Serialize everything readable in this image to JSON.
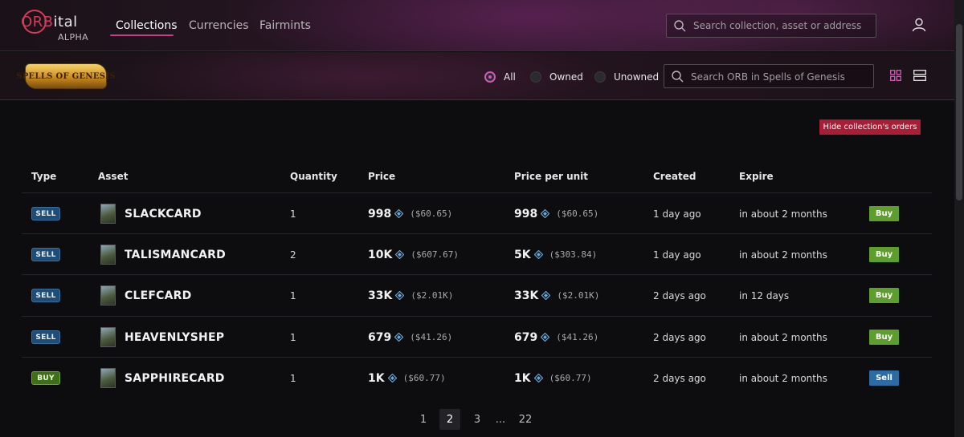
{
  "brand": {
    "logo_main": "ORBital",
    "logo_sub": "ALPHA"
  },
  "nav": {
    "collections": "Collections",
    "currencies": "Currencies",
    "fairmints": "Fairmints"
  },
  "top_search": {
    "placeholder": "Search collection, asset or address"
  },
  "collection": {
    "logo_text": "SPELLS OF GENESIS",
    "filters": {
      "all": "All",
      "owned": "Owned",
      "unowned": "Unowned",
      "selected": "All"
    },
    "search_placeholder": "Search ORB in Spells of Genesis"
  },
  "hide_orders_label": "Hide collection's orders",
  "table": {
    "headers": {
      "type": "Type",
      "asset": "Asset",
      "quantity": "Quantity",
      "price": "Price",
      "ppu": "Price per unit",
      "created": "Created",
      "expire": "Expire"
    },
    "rows": [
      {
        "type": "SELL",
        "asset": "SLACKCARD",
        "quantity": "1",
        "price": "998",
        "price_usd": "($60.65)",
        "ppu": "998",
        "ppu_usd": "($60.65)",
        "created": "1 day ago",
        "expire": "in about 2 months",
        "action": "Buy"
      },
      {
        "type": "SELL",
        "asset": "TALISMANCARD",
        "quantity": "2",
        "price": "10K",
        "price_usd": "($607.67)",
        "ppu": "5K",
        "ppu_usd": "($303.84)",
        "created": "1 day ago",
        "expire": "in about 2 months",
        "action": "Buy"
      },
      {
        "type": "SELL",
        "asset": "CLEFCARD",
        "quantity": "1",
        "price": "33K",
        "price_usd": "($2.01K)",
        "ppu": "33K",
        "ppu_usd": "($2.01K)",
        "created": "2 days ago",
        "expire": "in 12 days",
        "action": "Buy"
      },
      {
        "type": "SELL",
        "asset": "HEAVENLYSHEP",
        "quantity": "1",
        "price": "679",
        "price_usd": "($41.26)",
        "ppu": "679",
        "ppu_usd": "($41.26)",
        "created": "2 days ago",
        "expire": "in about 2 months",
        "action": "Buy"
      },
      {
        "type": "BUY",
        "asset": "SAPPHIRECARD",
        "quantity": "1",
        "price": "1K",
        "price_usd": "($60.77)",
        "ppu": "1K",
        "ppu_usd": "($60.77)",
        "created": "2 days ago",
        "expire": "in about 2 months",
        "action": "Sell"
      }
    ]
  },
  "pagination": {
    "p1": "1",
    "p2": "2",
    "p3": "3",
    "ellipsis": "...",
    "last": "22",
    "current": "2"
  },
  "icons": {
    "search": "search-icon",
    "user": "user-icon",
    "grid": "grid-view-icon",
    "list": "list-view-icon",
    "orb": "orb-currency-icon"
  },
  "colors": {
    "accent": "#cf5ab8",
    "sell_badge": "#1f4d76",
    "buy_badge": "#3f6f17",
    "buy_button": "#5d9e2d",
    "sell_button": "#2c6ba3",
    "hide_button": "#a81e36"
  }
}
